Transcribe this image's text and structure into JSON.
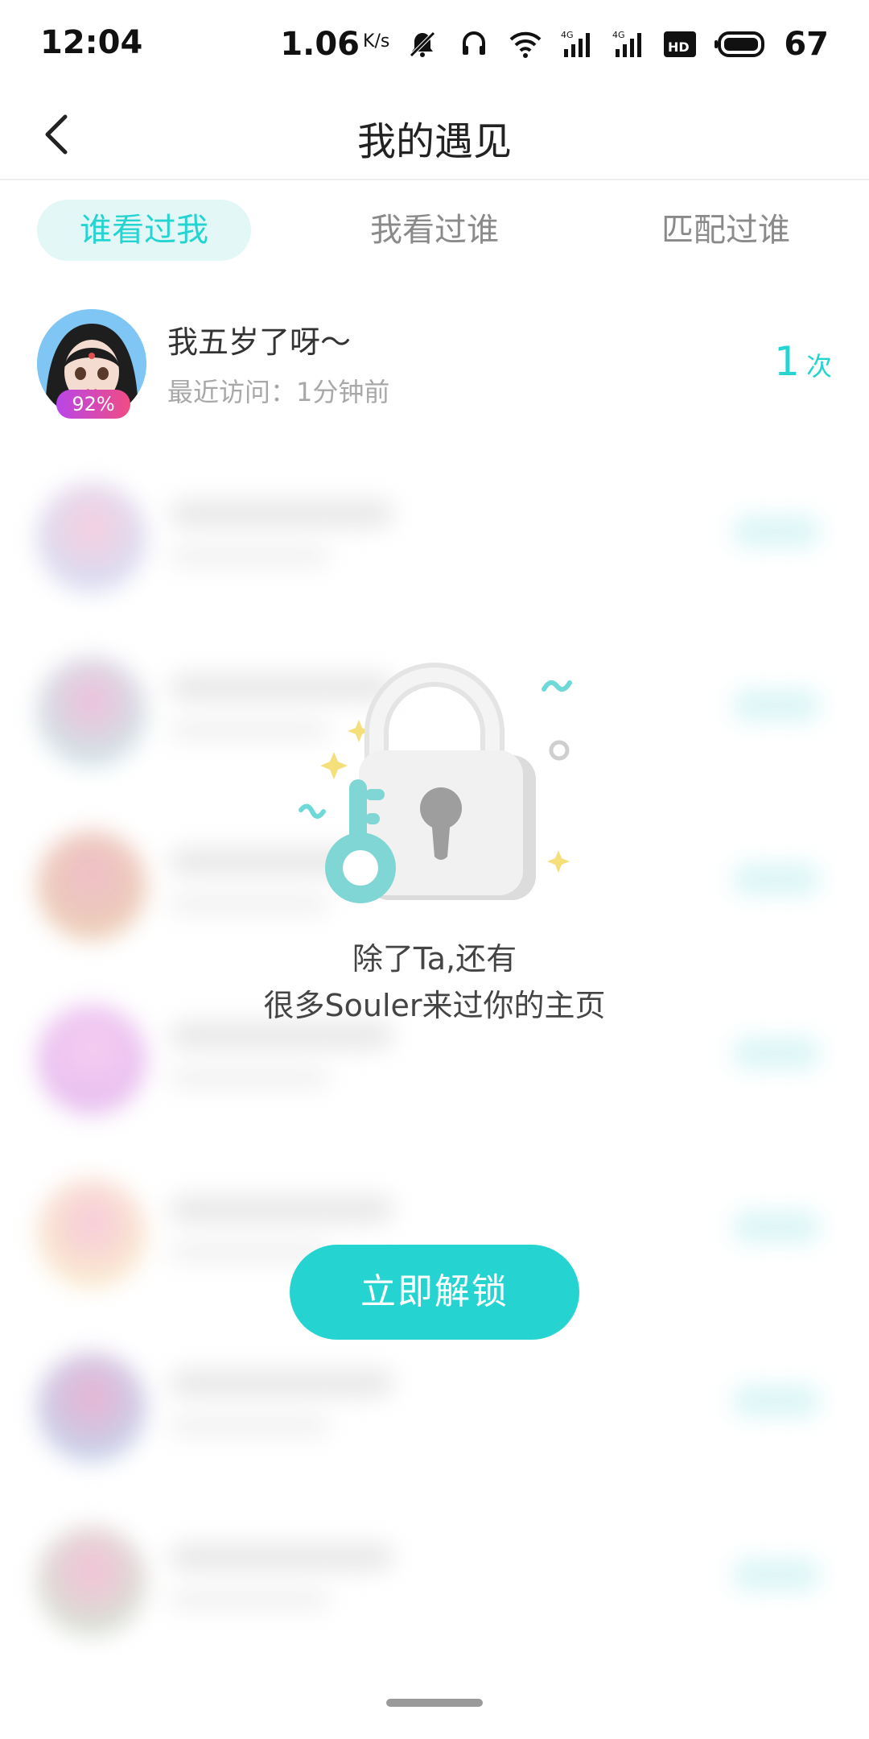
{
  "status_bar": {
    "time": "12:04",
    "net_speed": "1.06",
    "net_unit": "K/s",
    "battery": "67",
    "icons": [
      "mute-bell-icon",
      "headset-icon",
      "wifi-icon",
      "signal-4g-icon",
      "signal-4g-icon",
      "hd-icon",
      "battery-icon"
    ]
  },
  "header": {
    "title": "我的遇见",
    "back_icon": "chevron-left-icon"
  },
  "tabs": [
    {
      "label": "谁看过我",
      "active": true
    },
    {
      "label": "我看过谁",
      "active": false
    },
    {
      "label": "匹配过谁",
      "active": false
    }
  ],
  "visitor": {
    "name": "我五岁了呀～",
    "recent_visit": "最近访问：1分钟前",
    "match": "92%",
    "count": "1",
    "count_unit": "次"
  },
  "locked": {
    "line1": "除了Ta,还有",
    "line2": "很多Souler来过你的主页",
    "button": "立即解锁"
  },
  "colors": {
    "accent": "#25d4d0",
    "tab_active_bg": "#e3f7f7",
    "badge_gradient": [
      "#b846e8",
      "#f04c83"
    ]
  }
}
